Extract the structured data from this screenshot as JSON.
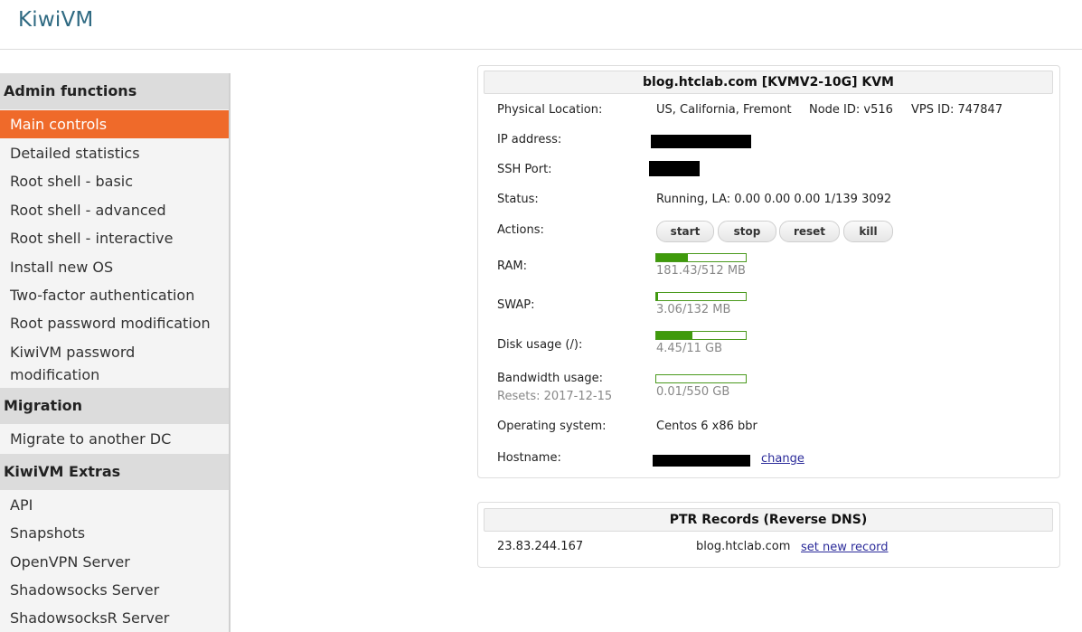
{
  "app": {
    "logo": "KiwiVM"
  },
  "sidebar": {
    "admin_header": "Admin functions",
    "admin_items": [
      {
        "label": "Main controls"
      },
      {
        "label": "Detailed statistics"
      },
      {
        "label": "Root shell - basic"
      },
      {
        "label": "Root shell - advanced"
      },
      {
        "label": "Root shell - interactive"
      },
      {
        "label": "Install new OS"
      },
      {
        "label": "Two-factor authentication"
      },
      {
        "label": "Root password modification"
      },
      {
        "label": "KiwiVM password"
      },
      {
        "label": "modification"
      }
    ],
    "migration_header": "Migration",
    "migration_items": [
      {
        "label": "Migrate to another DC"
      }
    ],
    "extras_header": "KiwiVM Extras",
    "extras_items": [
      {
        "label": "API"
      },
      {
        "label": "Snapshots"
      },
      {
        "label": "OpenVPN Server"
      },
      {
        "label": "Shadowsocks Server"
      },
      {
        "label": "ShadowsocksR Server"
      }
    ]
  },
  "server": {
    "title": "blog.htclab.com   [KVMV2-10G]   KVM",
    "location_label": "Physical Location:",
    "location_value": "US, California, Fremont",
    "node_id": "Node ID: v516",
    "vps_id": "VPS ID: 747847",
    "ip_label": "IP address:",
    "ssh_label": "SSH Port:",
    "status_label": "Status:",
    "status_value": "Running, LA: 0.00 0.00 0.00 1/139 3092",
    "actions_label": "Actions:",
    "actions": {
      "start": "start",
      "stop": "stop",
      "reset": "reset",
      "kill": "kill"
    },
    "ram_label": "RAM:",
    "ram_value": "181.43/512 MB",
    "ram_fraction": 0.354,
    "swap_label": "SWAP:",
    "swap_value": "3.06/132 MB",
    "swap_fraction": 0.023,
    "disk_label": "Disk usage (/):",
    "disk_value": "4.45/11 GB",
    "disk_fraction": 0.405,
    "bw_label": "Bandwidth usage:",
    "bw_resets": "Resets: 2017-12-15",
    "bw_value": "0.01/550 GB",
    "bw_fraction": 0.0,
    "os_label": "Operating system:",
    "os_value": "Centos 6 x86 bbr",
    "hostname_label": "Hostname:",
    "hostname_change": "change"
  },
  "ptr": {
    "title": "PTR Records (Reverse DNS)",
    "ip": "23.83.244.167",
    "host": "blog.htclab.com",
    "set_link": "set new record"
  },
  "colors": {
    "accent": "#ef6a2a",
    "bar_fill": "#3f9a0c",
    "logo": "#2f6a82"
  }
}
